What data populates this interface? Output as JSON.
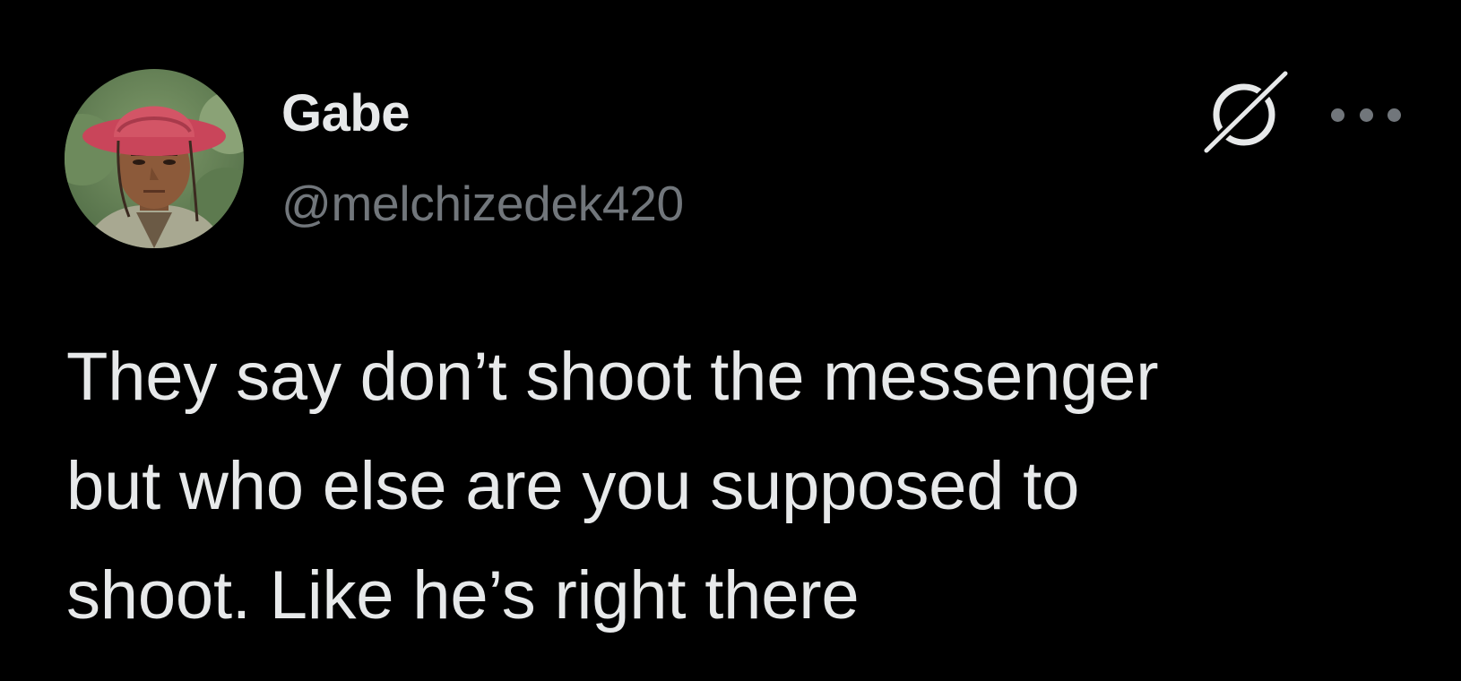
{
  "tweet": {
    "author": {
      "display_name": "Gabe",
      "handle": "@melchizedek420",
      "avatar_icon": "avatar-photo-person-red-hat"
    },
    "actions": {
      "grok_icon": "grok-icon",
      "more_icon": "more-horizontal-icon"
    },
    "text": "They say don’t shoot the messenger\nbut who else are you supposed to\nshoot. Like he’s right there"
  },
  "colors": {
    "background": "#000000",
    "primary_text": "#e7e9ea",
    "secondary_text": "#71767b"
  }
}
